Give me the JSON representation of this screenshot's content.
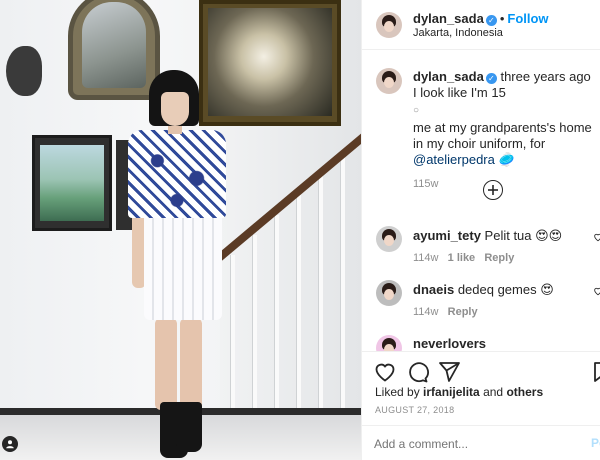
{
  "photo": {
    "alt_semantic": "woman-standing-by-staircase",
    "tag_icon": "user-tag-icon"
  },
  "header": {
    "username": "dylan_sada",
    "verified": true,
    "separator": "•",
    "follow_label": "Follow",
    "location": "Jakarta, Indonesia"
  },
  "caption": {
    "username": "dylan_sada",
    "line1": "three years ago I look like I'm 15",
    "line2": "○",
    "line3": "me at my grandparents's home in my choir uniform, for",
    "mention": "@atelierpedra",
    "emoji": "🥏",
    "time": "115w"
  },
  "load_more_icon": "plus-circle-icon",
  "comments": [
    {
      "username": "ayumi_tety",
      "text": "Pelit tua 😍😍",
      "time": "114w",
      "likes": "1 like",
      "reply": "Reply"
    },
    {
      "username": "dnaeis",
      "text": "dedeq gemes 😍",
      "time": "114w",
      "likes": "",
      "reply": "Reply"
    },
    {
      "username": "neverlovers",
      "text": "",
      "time": "",
      "likes": "",
      "reply": ""
    }
  ],
  "actions": {
    "like_icon": "heart-icon",
    "comment_icon": "comment-icon",
    "share_icon": "paper-plane-icon",
    "save_icon": "bookmark-icon"
  },
  "likes": {
    "prefix": "Liked by",
    "user": "irfanijelita",
    "conjunction": "and",
    "others": "others"
  },
  "date": "AUGUST 27, 2018",
  "comment_box": {
    "placeholder": "Add a comment...",
    "post_label": "Po"
  },
  "colors": {
    "accent": "#0095f6",
    "verified": "#3897f0",
    "muted": "#8e8e8e",
    "text": "#262626"
  }
}
